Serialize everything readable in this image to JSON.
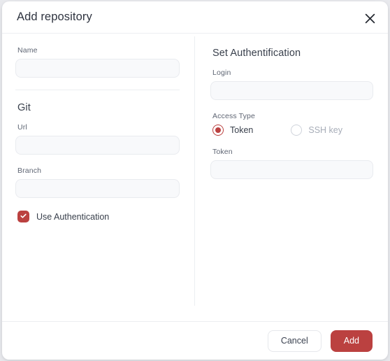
{
  "dialog": {
    "title": "Add repository",
    "close_icon": "close-x-icon"
  },
  "left_column": {
    "name_field": {
      "label": "Name",
      "value": "",
      "placeholder": ""
    },
    "git_heading": "Git",
    "url_field": {
      "label": "Url",
      "value": "",
      "placeholder": ""
    },
    "branch_field": {
      "label": "Branch",
      "value": "",
      "placeholder": ""
    },
    "use_auth_checkbox": {
      "label": "Use Authentication",
      "checked": true,
      "icon": "check-icon"
    }
  },
  "right_column": {
    "heading": "Set Authentification",
    "login_field": {
      "label": "Login",
      "value": "",
      "placeholder": ""
    },
    "access_type": {
      "label": "Access Type",
      "options": [
        {
          "label": "Token",
          "selected": true
        },
        {
          "label": "SSH key",
          "selected": false
        }
      ]
    },
    "token_field": {
      "label": "Token",
      "value": "",
      "placeholder": ""
    }
  },
  "footer": {
    "cancel_label": "Cancel",
    "add_label": "Add"
  },
  "colors": {
    "accent": "#bb4140",
    "dialog_background": "#ffffff",
    "page_background": "#e9eaee",
    "input_background": "#f8f9fb",
    "border": "#eceef1",
    "text_primary": "#39404c",
    "text_muted": "#5e6573",
    "text_disabled": "#a7adb8"
  }
}
